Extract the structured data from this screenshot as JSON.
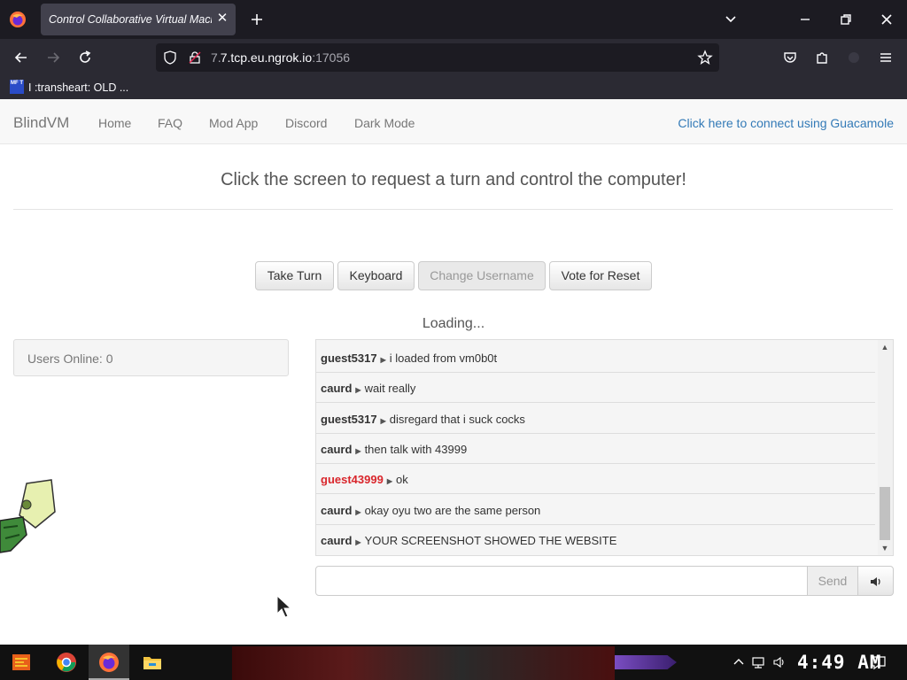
{
  "browser": {
    "tab_title": "Control Collaborative Virtual Machine",
    "url_main": "7.tcp.eu.ngrok.io",
    "url_port": ":17056",
    "bookmark_label": "I :transheart: OLD ...",
    "bookmark_icon_text": "MF T"
  },
  "site": {
    "brand": "BlindVM",
    "nav": [
      "Home",
      "FAQ",
      "Mod App",
      "Discord",
      "Dark Mode"
    ],
    "guac_link": "Click here to connect using Guacamole",
    "headline": "Click the screen to request a turn and control the computer!",
    "buttons": {
      "take_turn": "Take Turn",
      "keyboard": "Keyboard",
      "change_username": "Change Username",
      "vote_reset": "Vote for Reset"
    },
    "loading": "Loading...",
    "users_online": "Users Online: 0",
    "chat": [
      {
        "user": "guest5317",
        "msg": "i loaded from vm0b0t"
      },
      {
        "user": "caurd",
        "msg": "wait really"
      },
      {
        "user": "guest5317",
        "msg": "disregard that i suck cocks"
      },
      {
        "user": "caurd",
        "msg": "then talk with 43999"
      },
      {
        "user": "guest43999",
        "msg": "ok"
      },
      {
        "user": "caurd",
        "msg": "okay oyu two are the same person"
      },
      {
        "user": "caurd",
        "msg": "YOUR SCREENSHOT SHOWED THE WEBSITE"
      }
    ],
    "send_label": "Send"
  },
  "taskbar": {
    "clock": "4:49 AM"
  },
  "colors": {
    "link": "#337ab7",
    "highlight_user": "#d9262c"
  }
}
